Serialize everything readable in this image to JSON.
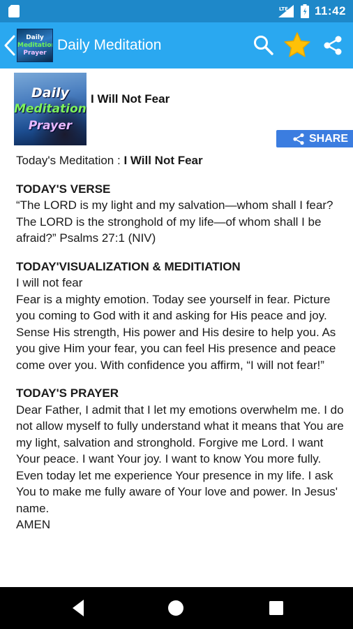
{
  "status_bar": {
    "time": "11:42",
    "network_label": "LTE"
  },
  "app_bar": {
    "title": "Daily Meditation",
    "logo_lines": [
      "Daily",
      "Meditation",
      "Prayer"
    ]
  },
  "post": {
    "thumbnail_lines": [
      "Daily",
      "Meditation",
      "Prayer"
    ],
    "title": "I Will Not Fear",
    "share_label": "SHARE",
    "meditation_prefix": "Today's Meditation : ",
    "meditation_title": "I Will Not Fear",
    "sections": [
      {
        "heading": "TODAY'S VERSE",
        "body": "“The LORD is my light and my salvation—whom shall I fear? The LORD is the stronghold of my life—of whom shall I be afraid?” Psalms 27:1 (NIV)"
      },
      {
        "heading": "TODAY'VISUALIZATION & MEDITIATION",
        "body": "I will not fear\nFear is a mighty emotion. Today see yourself in fear. Picture you coming to God with it and asking for His peace and joy. Sense His strength, His power and His desire to help you. As you give Him your fear, you can feel His presence and peace come over you. With confidence you affirm, “I will not fear!”"
      },
      {
        "heading": "TODAY'S PRAYER",
        "body": "Dear Father, I admit that I let my emotions overwhelm me. I do not allow myself to fully understand what it means that You are my light, salvation and stronghold. Forgive me Lord. I want Your peace. I want Your joy. I want to know You more fully. Even today let me experience Your presence in my life. I ask You to make me fully aware of Your love and power. In Jesus' name.\nAMEN"
      }
    ]
  },
  "colors": {
    "status_bar": "#1e88c9",
    "app_bar": "#2aa8f0",
    "share_button": "#3b7de0",
    "star": "#ffc107",
    "nav_bar": "#000000"
  },
  "icons": {
    "status_left": "sd-card-icon",
    "signal": "signal-icon",
    "battery": "battery-icon",
    "back": "back-arrow-icon",
    "search": "search-icon",
    "favorite": "star-icon",
    "share": "share-icon",
    "nav_back": "nav-back-icon",
    "nav_home": "nav-home-icon",
    "nav_recent": "nav-recent-icon"
  }
}
